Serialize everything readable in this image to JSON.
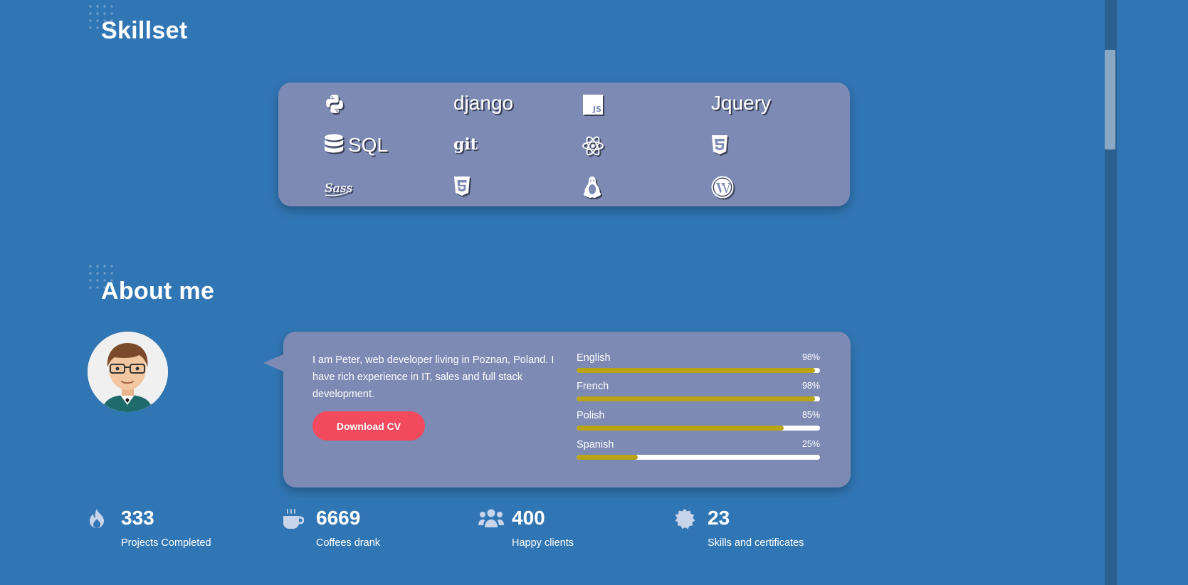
{
  "skillset": {
    "title": "Skillset",
    "items": [
      {
        "icon": "python-icon",
        "label": ""
      },
      {
        "icon": "",
        "label": "django"
      },
      {
        "icon": "javascript-icon",
        "label": ""
      },
      {
        "icon": "",
        "label": "Jquery"
      },
      {
        "icon": "database-icon",
        "label": "SQL"
      },
      {
        "icon": "",
        "label": "git"
      },
      {
        "icon": "react-icon",
        "label": ""
      },
      {
        "icon": "css3-icon",
        "label": ""
      },
      {
        "icon": "sass-icon",
        "label": ""
      },
      {
        "icon": "html5-icon",
        "label": ""
      },
      {
        "icon": "linux-icon",
        "label": ""
      },
      {
        "icon": "wordpress-icon",
        "label": ""
      }
    ]
  },
  "about": {
    "title": "About me",
    "bio": "I am Peter, web developer living in Poznan, Poland. I have rich experience in IT, sales and full stack development.",
    "cv_button": "Download CV",
    "languages": [
      {
        "name": "English",
        "percent_label": "98%",
        "value": 98
      },
      {
        "name": "French",
        "percent_label": "98%",
        "value": 98
      },
      {
        "name": "Polish",
        "percent_label": "85%",
        "value": 85
      },
      {
        "name": "Spanish",
        "percent_label": "25%",
        "value": 25
      }
    ]
  },
  "stats": [
    {
      "icon": "fire-icon",
      "number": "333",
      "label": "Projects Completed"
    },
    {
      "icon": "coffee-icon",
      "number": "6669",
      "label": "Coffees drank"
    },
    {
      "icon": "users-icon",
      "number": "400",
      "label": "Happy clients"
    },
    {
      "icon": "certificate-icon",
      "number": "23",
      "label": "Skills and certificates"
    }
  ],
  "colors": {
    "background": "#3176b4",
    "card": "#7c8ab4",
    "accent_button": "#f44a5d",
    "bar_fill": "#b8a415",
    "stat_icon": "#c8d4ea"
  }
}
